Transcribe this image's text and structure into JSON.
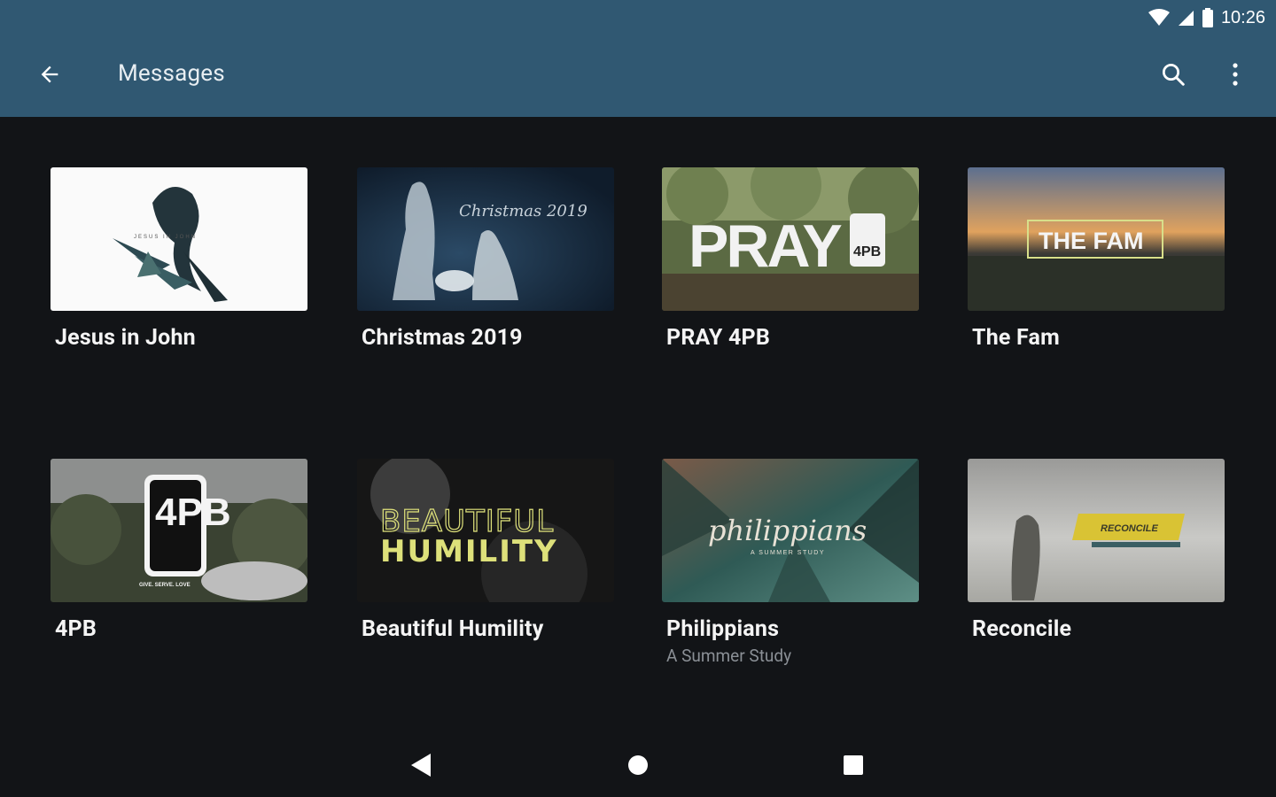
{
  "status_bar": {
    "time": "10:26"
  },
  "app_bar": {
    "title": "Messages",
    "background": "#305872"
  },
  "series": [
    {
      "title": "Jesus in John",
      "thumbnail": "jesus-in-john-artwork",
      "thumb_text": "JESUS IN JOHN"
    },
    {
      "title": "Christmas 2019",
      "thumbnail": "christmas-2019-artwork",
      "thumb_text": "Christmas 2019"
    },
    {
      "title": "PRAY 4PB",
      "thumbnail": "pray-4pb-artwork",
      "thumb_text": "PRAY",
      "thumb_badge": "4PB"
    },
    {
      "title": "The Fam",
      "thumbnail": "the-fam-artwork",
      "thumb_text": "THE FAM"
    },
    {
      "title": "4PB",
      "thumbnail": "4pb-artwork",
      "thumb_badge": "4PB",
      "thumb_text": "GIVE. SERVE. LOVE"
    },
    {
      "title": "Beautiful Humility",
      "thumbnail": "beautiful-humility-artwork",
      "thumb_text": "BEAUTIFUL",
      "thumb_text2": "HUMILITY"
    },
    {
      "title": "Philippians",
      "subtitle": "A Summer Study",
      "thumbnail": "philippians-artwork",
      "thumb_text": "philippians",
      "thumb_text2": "A SUMMER STUDY"
    },
    {
      "title": "Reconcile",
      "thumbnail": "reconcile-artwork",
      "thumb_text": "RECONCILE"
    }
  ],
  "nav_bar": {
    "back": "back-triangle-icon",
    "home": "home-circle-icon",
    "recents": "recents-square-icon"
  }
}
